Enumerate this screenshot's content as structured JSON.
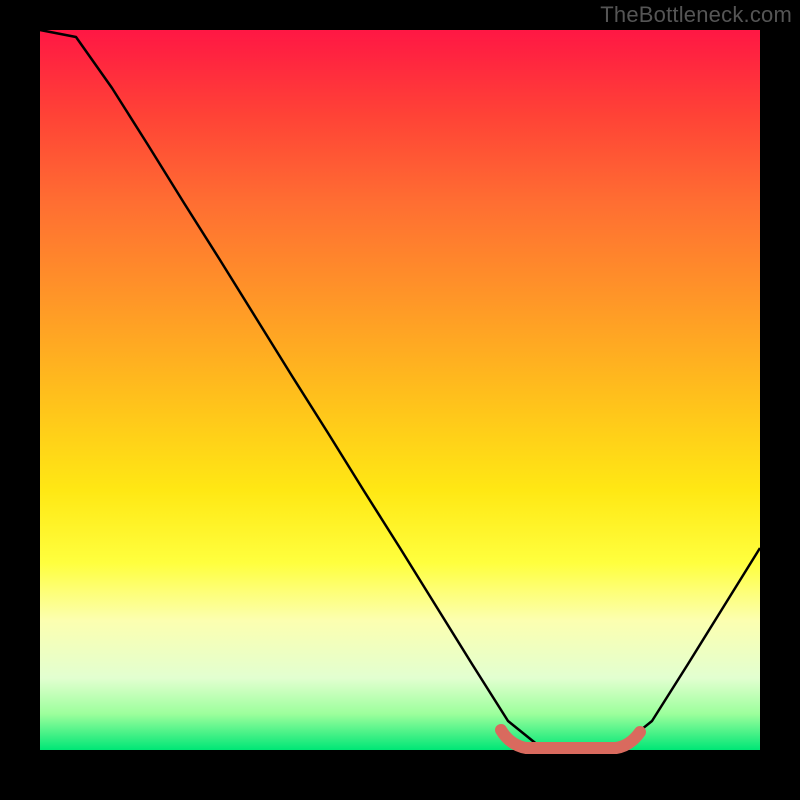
{
  "watermark": "TheBottleneck.com",
  "chart_data": {
    "type": "line",
    "title": "",
    "xlabel": "",
    "ylabel": "",
    "xlim": [
      0,
      100
    ],
    "ylim": [
      0,
      100
    ],
    "x": [
      0,
      5,
      10,
      15,
      20,
      25,
      30,
      35,
      40,
      45,
      50,
      55,
      60,
      65,
      70,
      75,
      80,
      85,
      90,
      95,
      100
    ],
    "values": [
      100,
      99,
      92,
      84,
      76,
      68,
      60,
      52,
      44,
      36,
      28,
      20,
      12,
      4,
      0,
      0,
      0,
      4,
      12,
      20,
      28
    ],
    "highlight": {
      "x_start": 64,
      "x_end": 82,
      "color": "#d96a5e"
    },
    "gradient_colors": [
      "#ff1744",
      "#ff6e32",
      "#ffe814",
      "#00e676"
    ]
  }
}
